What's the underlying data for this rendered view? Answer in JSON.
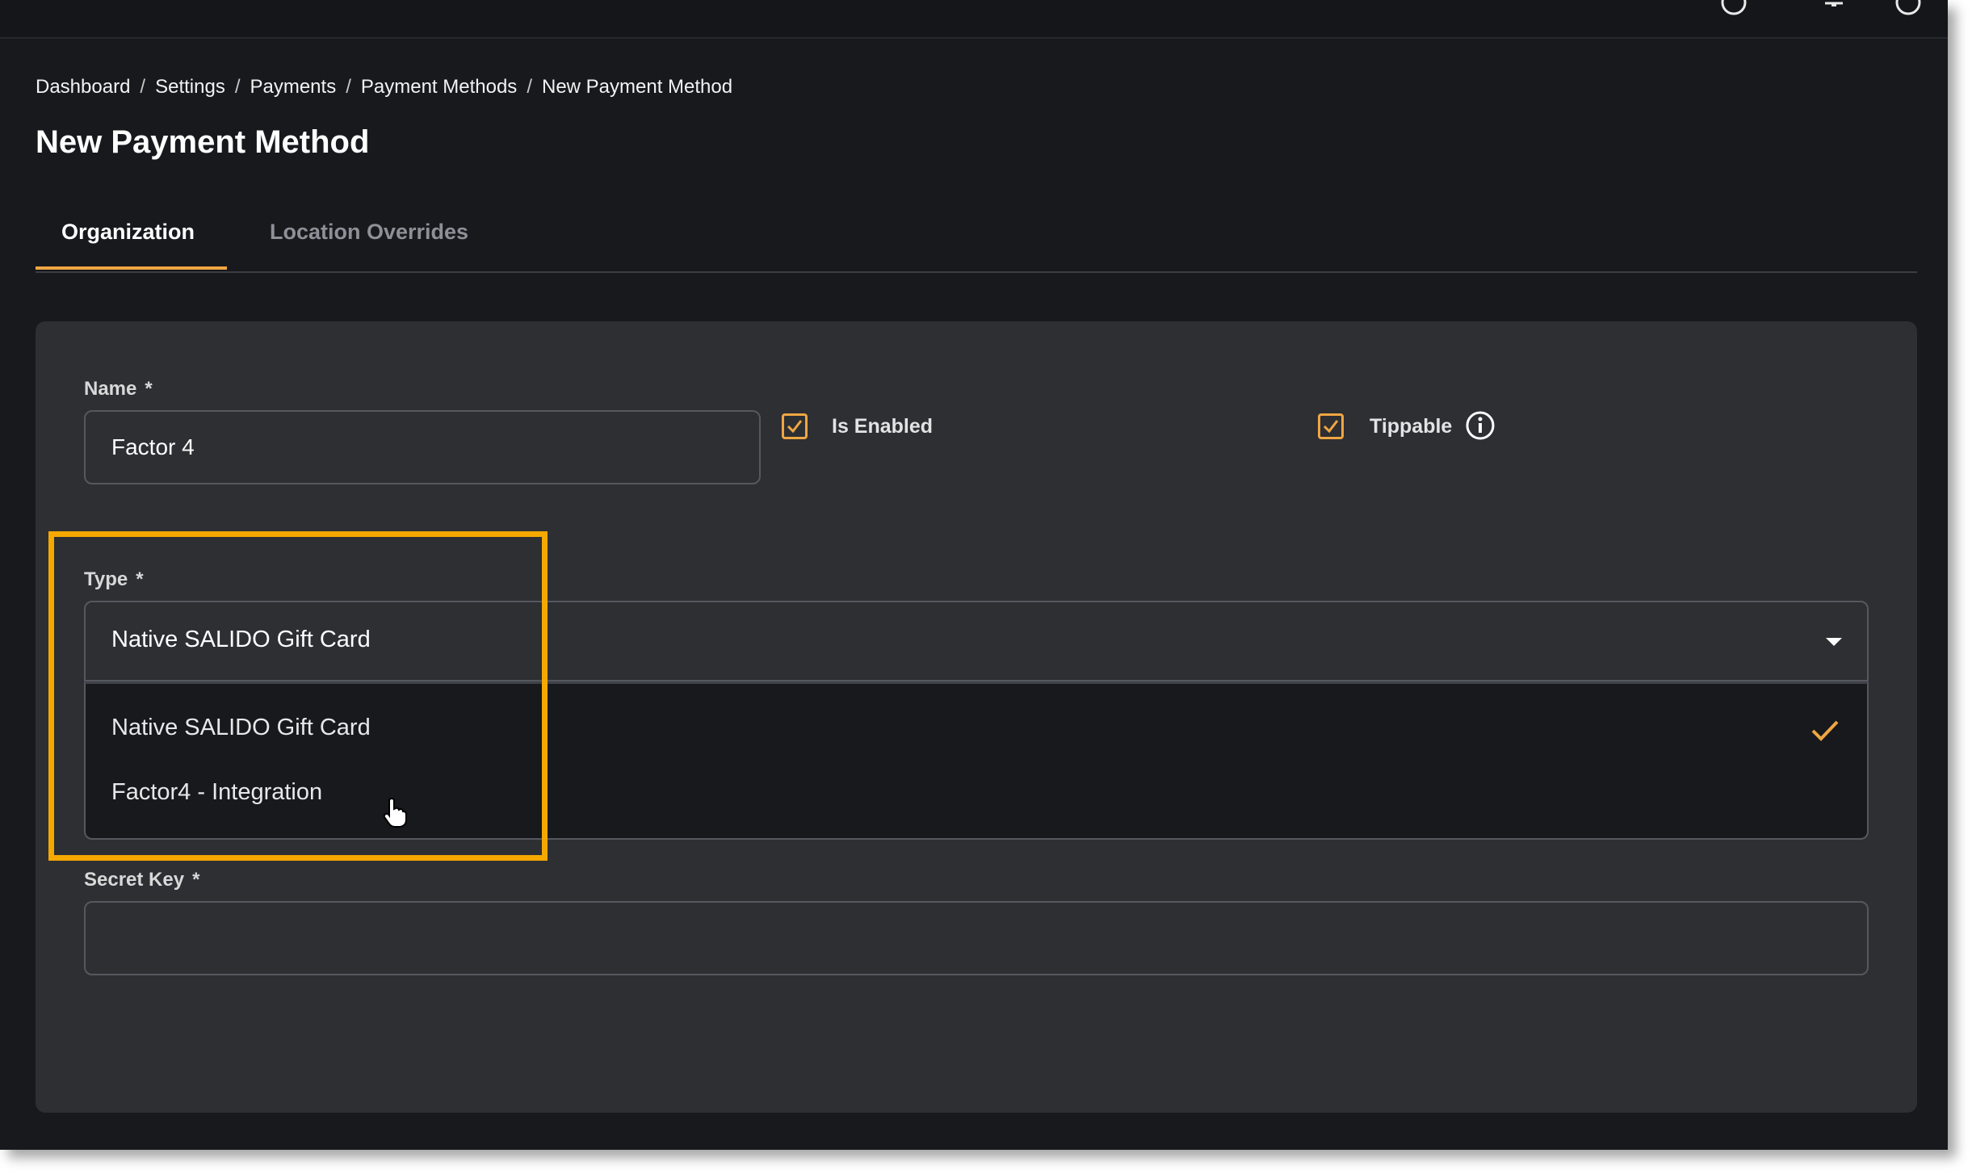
{
  "breadcrumb": {
    "items": [
      "Dashboard",
      "Settings",
      "Payments",
      "Payment Methods",
      "New Payment Method"
    ],
    "separator": "/"
  },
  "page": {
    "title": "New Payment Method"
  },
  "tabs": [
    {
      "label": "Organization",
      "active": true
    },
    {
      "label": "Location Overrides",
      "active": false
    }
  ],
  "form": {
    "name": {
      "label": "Name",
      "required_mark": "*",
      "value": "Factor 4"
    },
    "is_enabled": {
      "label": "Is Enabled",
      "checked": true
    },
    "tippable": {
      "label": "Tippable",
      "checked": true,
      "info_icon": "info-icon"
    },
    "type": {
      "label": "Type",
      "required_mark": "*",
      "value": "Native SALIDO Gift Card",
      "options": [
        "Native SALIDO Gift Card",
        "Factor4 - Integration"
      ],
      "selected_option": "Native SALIDO Gift Card"
    },
    "secret_key": {
      "label": "Secret Key",
      "required_mark": "*",
      "value": ""
    }
  },
  "colors": {
    "accent": "#f0a642",
    "highlight": "#f5a800",
    "background": "#17191d",
    "card": "#2d2f33"
  },
  "icons": [
    "check-icon",
    "info-icon",
    "chevron-down-icon",
    "hand-cursor-icon"
  ]
}
